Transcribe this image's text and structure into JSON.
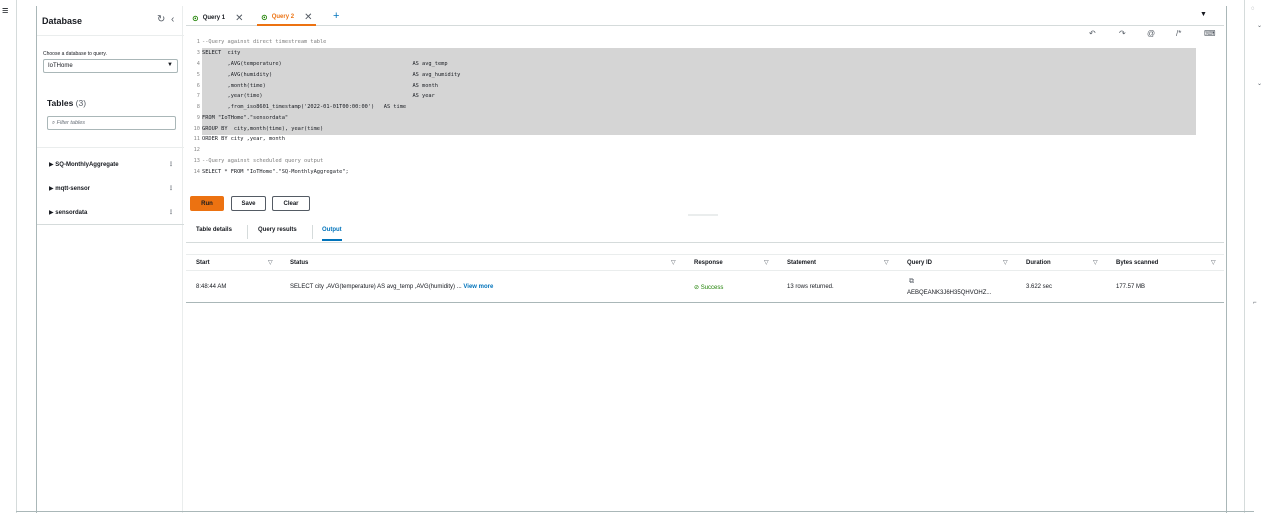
{
  "nav": {
    "menu_icon": "hamburger-icon",
    "menu_glyph": "≡"
  },
  "sidebar": {
    "title": "Database",
    "refresh_glyph": "↻",
    "collapse_glyph": "‹",
    "db_label": "Choose a database to query.",
    "db_selected": "IoTHome",
    "tables_title": "Tables",
    "tables_count": "(3)",
    "filter_placeholder": "Filter tables",
    "tables": [
      {
        "name": "SQ-MonthlyAggregate"
      },
      {
        "name": "mqtt-sensor"
      },
      {
        "name": "sensordata"
      }
    ]
  },
  "tabs": [
    {
      "label": "Query 1",
      "active": false
    },
    {
      "label": "Query 2",
      "active": true
    }
  ],
  "toolbar": {
    "add_tab": "+",
    "more": "▼",
    "undo": "↶",
    "redo": "↷",
    "search": "@",
    "comment": "/*",
    "keyboard": "⌨"
  },
  "editor": {
    "lines": [
      {
        "n": "1",
        "text": "--Query against direct timestream table"
      },
      {
        "n": "3",
        "text": "SELECT  city"
      },
      {
        "n": "4",
        "text": "        ,AVG(temperature)                                         AS avg_temp"
      },
      {
        "n": "5",
        "text": "        ,AVG(humidity)                                            AS avg_humidity"
      },
      {
        "n": "6",
        "text": "        ,month(time)                                              AS month"
      },
      {
        "n": "7",
        "text": "        ,year(time)                                               AS year"
      },
      {
        "n": "8",
        "text": "        ,from_iso8601_timestamp('2022-01-01T00:00:00')   AS time"
      },
      {
        "n": "9",
        "text": "FROM \"IoTHome\".\"sensordata\""
      },
      {
        "n": "10",
        "text": "GROUP BY  city,month(time), year(time)"
      },
      {
        "n": "11",
        "text": "ORDER BY city ,year, month"
      },
      {
        "n": "12",
        "text": ""
      },
      {
        "n": "13",
        "text": "--Query against scheduled query output"
      },
      {
        "n": "14",
        "text": "SELECT * FROM \"IoTHome\".\"SQ-MonthlyAggregate\";"
      }
    ]
  },
  "actions": {
    "run": "Run",
    "save": "Save",
    "clear": "Clear"
  },
  "result_tabs": [
    "Table details",
    "Query results",
    "Output"
  ],
  "grid": {
    "headers": [
      "Start",
      "Status",
      "Response",
      "Statement",
      "Query ID",
      "Duration",
      "Bytes scanned"
    ],
    "row": {
      "start": "8:48:44 AM",
      "status": "SELECT city ,AVG(temperature) AS avg_temp ,AVG(humidity) ...",
      "view_more": "View more",
      "response": "Success",
      "statement": "13 rows returned.",
      "query_id": "AEBQEANK3J6H35QHVOHZ...",
      "duration": "3.622 sec",
      "bytes": "177.57 MB"
    }
  },
  "colors": {
    "accent": "#ec7211",
    "link": "#0073bb",
    "success": "#1d8102"
  }
}
